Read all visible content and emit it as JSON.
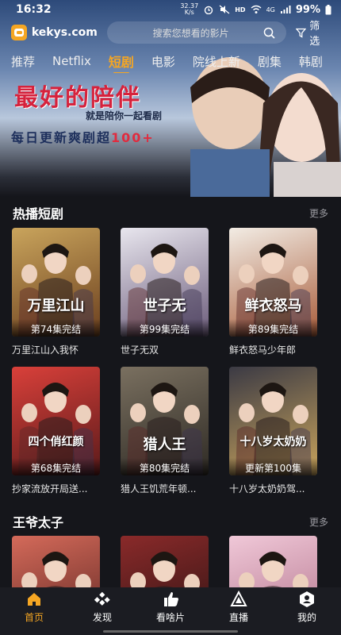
{
  "status_bar": {
    "time": "16:32",
    "net_speed_value": "32.37",
    "net_speed_unit": "K/s",
    "network": "4G",
    "battery": "99%"
  },
  "header": {
    "logo_text": "kekys.com",
    "search_placeholder": "搜索您想看的影片",
    "filter_label": "筛选"
  },
  "tabs": [
    {
      "label": "推荐"
    },
    {
      "label": "Netflix"
    },
    {
      "label": "短剧",
      "active": true
    },
    {
      "label": "电影"
    },
    {
      "label": "院线上新"
    },
    {
      "label": "剧集"
    },
    {
      "label": "韩剧"
    }
  ],
  "banner": {
    "title": "最好的陪伴",
    "subtitle": "就是陪你一起看剧",
    "slogan_main": "每日更新爽剧超",
    "slogan_count": "100+"
  },
  "sections": [
    {
      "title": "热播短剧",
      "more": "更多",
      "items": [
        {
          "title": "万里江山入我怀",
          "badge": "第74集完结",
          "poster_text": "万里江山",
          "colors": [
            "#c9a45c",
            "#6b3f1e"
          ]
        },
        {
          "title": "世子无双",
          "badge": "第99集完结",
          "poster_text": "世子无",
          "colors": [
            "#e8e6ee",
            "#6b5b7a"
          ]
        },
        {
          "title": "鲜衣怒马少年郎",
          "badge": "第89集完结",
          "poster_text": "鲜衣怒马",
          "colors": [
            "#f2ece4",
            "#a85c3a"
          ]
        },
        {
          "title": "抄家流放开局送...",
          "badge": "第68集完结",
          "poster_text": "四个俏红颜",
          "colors": [
            "#d9403a",
            "#5a1a1a"
          ]
        },
        {
          "title": "猎人王饥荒年顿...",
          "badge": "第80集完结",
          "poster_text": "猎人王",
          "colors": [
            "#7a7060",
            "#2e2a24"
          ]
        },
        {
          "title": "十八岁太奶奶驾...",
          "badge": "更新第100集",
          "poster_text": "十八岁太奶奶",
          "colors": [
            "#3b3a44",
            "#c9a45c"
          ]
        }
      ]
    },
    {
      "title": "王爷太子",
      "more": "更多",
      "items": [
        {
          "title": "",
          "badge": "",
          "poster_text": "",
          "colors": [
            "#d46a5a",
            "#5a2420"
          ]
        },
        {
          "title": "",
          "badge": "",
          "poster_text": "",
          "colors": [
            "#8a2a2a",
            "#2a1212"
          ]
        },
        {
          "title": "",
          "badge": "",
          "poster_text": "",
          "colors": [
            "#f0c8d8",
            "#b07088"
          ]
        }
      ]
    }
  ],
  "bottom_nav": [
    {
      "label": "首页",
      "icon": "home-icon",
      "active": true
    },
    {
      "label": "发现",
      "icon": "discover-icon"
    },
    {
      "label": "看啥片",
      "icon": "thumbs-up-icon"
    },
    {
      "label": "直播",
      "icon": "live-icon"
    },
    {
      "label": "我的",
      "icon": "profile-icon"
    }
  ],
  "accent_color": "#f5a623"
}
